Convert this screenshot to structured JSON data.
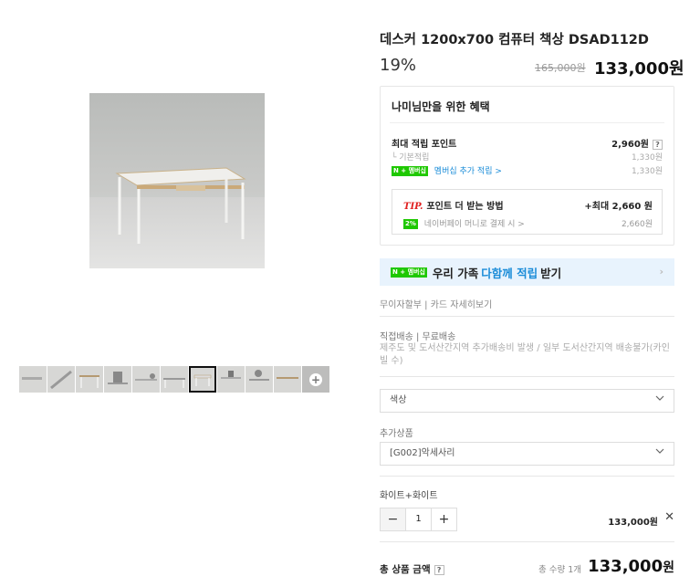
{
  "product": {
    "title": "데스커 1200x700 컴퓨터 책상 DSAD112D",
    "discount_rate": "19%",
    "original_price": "165,000원",
    "sale_price": "133,000원"
  },
  "gallery": {
    "thumbnail_count": 11,
    "active_index": 6
  },
  "benefits": {
    "title": "나미님만을 위한 혜택",
    "max_points_label": "최대 적립 포인트",
    "max_points_value": "2,960원",
    "basic_label": "└ 기본적립",
    "basic_value": "1,330원",
    "npay_badge": "N + 멤버십",
    "extra_label": "멤버십 추가 적립 >",
    "extra_value": "1,330원",
    "tip_prefix": "TIP.",
    "tip_label": "포인트 더 받는 방법",
    "tip_max": "+최대 2,660 원",
    "tip_badge": "2%",
    "tip_sub_label": "네이버페이 머니로 결제 시 >",
    "tip_sub_value": "2,660원"
  },
  "family": {
    "badge": "N + 멤버십",
    "text_before": "우리 가족",
    "highlight": "다함께 적립",
    "text_after": "받기"
  },
  "info": {
    "interest_free": "무이자할부 | 카드 자세히보기",
    "shipping_label": "직접배송 | 무료배송",
    "shipping_note": "제주도 및 도서산간지역 추가배송비 발생 / 일부 도서산간지역 배송불가(카인빌 수)"
  },
  "options": {
    "color_placeholder": "색상",
    "addon_label": "추가상품",
    "addon_value": "[G002]악세사리"
  },
  "cart": {
    "item_label": "화이트+화이트",
    "quantity": "1",
    "minus": "−",
    "plus": "+",
    "line_price": "133,000원",
    "close": "✕"
  },
  "total": {
    "label": "총 상품 금액",
    "count": "총 수량 1개",
    "price": "133,000",
    "won": "원"
  }
}
